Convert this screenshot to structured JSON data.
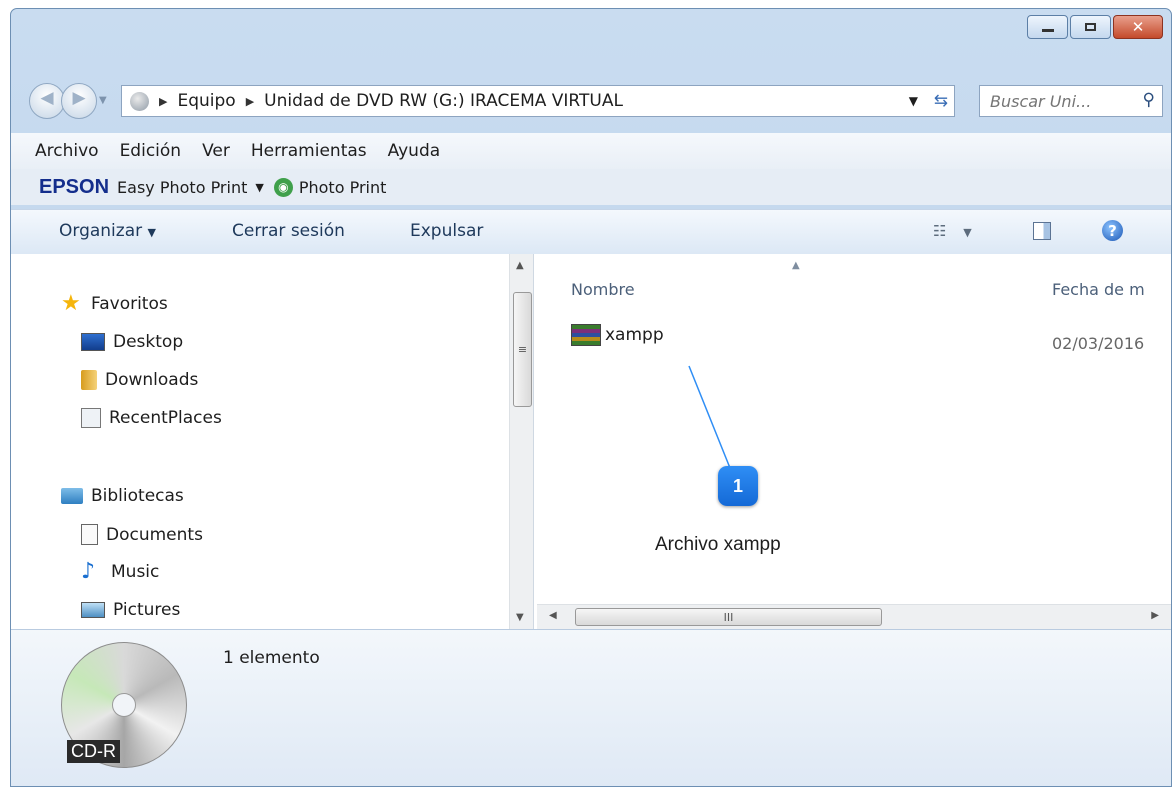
{
  "address": {
    "crumbs": [
      "Equipo",
      "Unidad de DVD RW (G:) IRACEMA VIRTUAL"
    ]
  },
  "search": {
    "placeholder": "Buscar Uni..."
  },
  "menu": [
    "Archivo",
    "Edición",
    "Ver",
    "Herramientas",
    "Ayuda"
  ],
  "epson": {
    "logo": "EPSON",
    "easy_photo_print": "Easy Photo Print",
    "photo_print": "Photo Print"
  },
  "toolbar": {
    "organize": "Organizar",
    "close_session": "Cerrar sesión",
    "eject": "Expulsar"
  },
  "nav": {
    "favorites": {
      "label": "Favoritos",
      "items": [
        "Desktop",
        "Downloads",
        "RecentPlaces"
      ]
    },
    "libraries": {
      "label": "Bibliotecas",
      "items": [
        "Documents",
        "Music",
        "Pictures"
      ]
    }
  },
  "columns": {
    "name": "Nombre",
    "date": "Fecha de m"
  },
  "files": [
    {
      "name": "xampp",
      "date": "02/03/2016",
      "icon": "winrar-archive-icon"
    }
  ],
  "callout": {
    "number": "1",
    "text": "Archivo xampp",
    "color": "#1a73e8"
  },
  "details": {
    "count": "1 elemento",
    "drive_label": "CD-R"
  },
  "colors": {
    "frame": "#b9d0ea",
    "close": "#c44a2b",
    "accent": "#1e395b"
  }
}
